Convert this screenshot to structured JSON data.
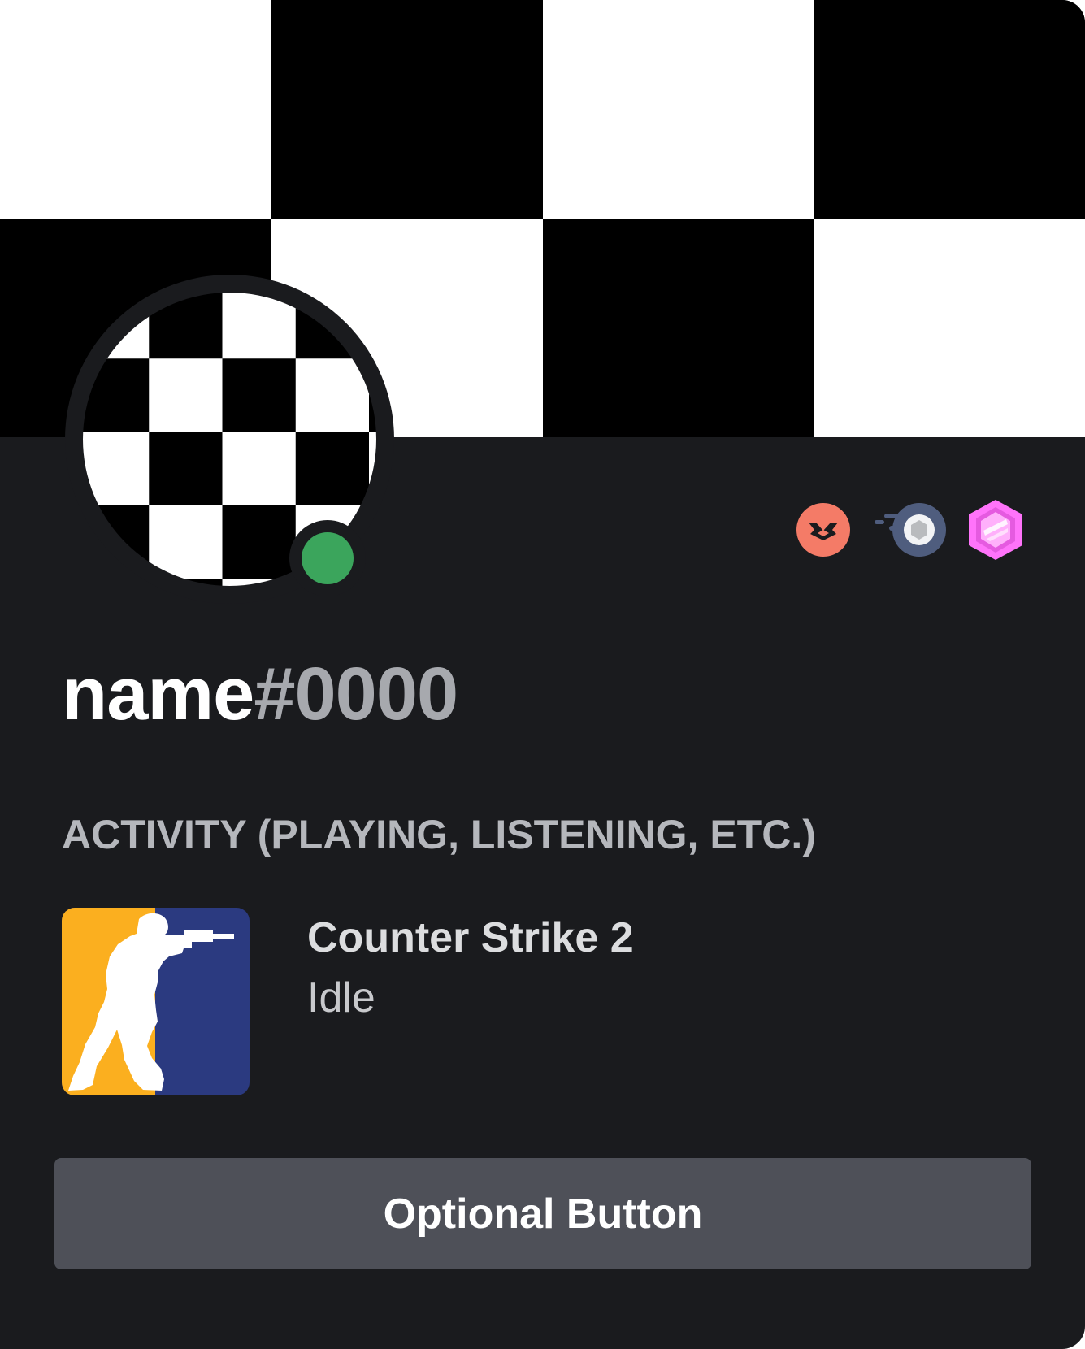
{
  "profile": {
    "name": "name",
    "discriminator": "#0000",
    "status": "online",
    "status_color": "#3ba55c",
    "avatar_icon": "checkerboard-avatar-icon",
    "banner_icon": "checkerboard-banner-icon"
  },
  "badges": [
    {
      "icon": "hypesquad-brilliance-badge-icon",
      "color": "#f47b67"
    },
    {
      "icon": "nitro-speed-badge-icon",
      "color": "#4f5d7e"
    },
    {
      "icon": "nitro-gem-badge-icon",
      "color": "#ff73fa"
    }
  ],
  "activity": {
    "section_title": "ACTIVITY (PLAYING, LISTENING, ETC.)",
    "game_name": "Counter Strike 2",
    "state": "Idle",
    "icon": "counter-strike-icon"
  },
  "button": {
    "label": "Optional Button"
  },
  "colors": {
    "card_bg": "#1a1b1e",
    "button_bg": "#4e5058",
    "tag_gray": "#a7a9ae"
  }
}
